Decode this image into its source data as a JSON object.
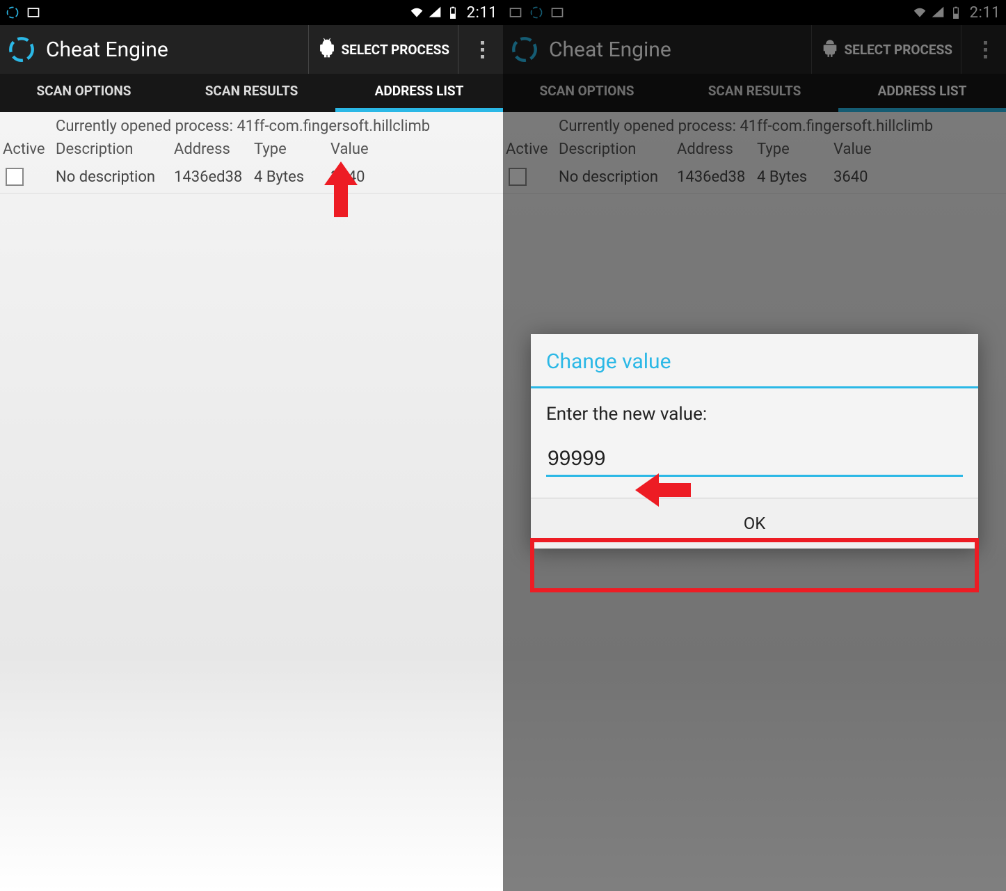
{
  "statusbar": {
    "time": "2:11"
  },
  "appbar": {
    "title": "Cheat Engine",
    "select_process": "SELECT PROCESS"
  },
  "tabs": {
    "scan_options": "SCAN OPTIONS",
    "scan_results": "SCAN RESULTS",
    "address_list": "ADDRESS LIST",
    "active_index": 2
  },
  "process_line": "Currently opened process: 41ff-com.fingersoft.hillclimb",
  "headers": {
    "active": "Active",
    "description": "Description",
    "address": "Address",
    "type": "Type",
    "value": "Value"
  },
  "rows": [
    {
      "description": "No description",
      "address": "1436ed38",
      "type": "4 Bytes",
      "value": "3640"
    }
  ],
  "dialog": {
    "title": "Change value",
    "label": "Enter the new value:",
    "input_value": "99999",
    "ok": "OK"
  }
}
